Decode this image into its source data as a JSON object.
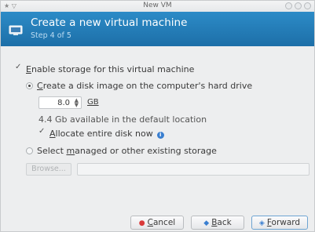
{
  "window": {
    "title": "New VM",
    "left_label": "★ ▽"
  },
  "banner": {
    "title": "Create a new virtual machine",
    "subtitle": "Step 4 of 5"
  },
  "storage": {
    "enable_label_mnemonic": "E",
    "enable_label_rest": "nable storage for this virtual machine",
    "enable_checked": true,
    "create_label_mnemonic": "C",
    "create_label_rest": "reate a disk image on the computer's hard drive",
    "create_selected": true,
    "size_value": "8.0",
    "size_unit": "GB",
    "available_text": "4.4 Gb available in the default location",
    "allocate_label_mnemonic": "A",
    "allocate_label_rest": "llocate entire disk now",
    "allocate_checked": true,
    "select_label_pre": "Select ",
    "select_label_mnemonic": "m",
    "select_label_rest": "anaged or other existing storage",
    "select_selected": false,
    "browse_label": "Browse...",
    "path_value": ""
  },
  "buttons": {
    "cancel_mnemonic": "C",
    "cancel_rest": "ancel",
    "back_mnemonic": "B",
    "back_rest": "ack",
    "forward_mnemonic": "F",
    "forward_rest": "orward"
  },
  "colors": {
    "banner": "#1d6fa8",
    "cancel_icon": "#d93a3a",
    "nav_icon": "#3a7fd0"
  },
  "icons": {
    "banner": "computer-monitor-icon",
    "cancel": "cancel-icon",
    "back": "back-arrow-icon",
    "forward": "forward-arrow-icon",
    "info": "info-icon"
  }
}
